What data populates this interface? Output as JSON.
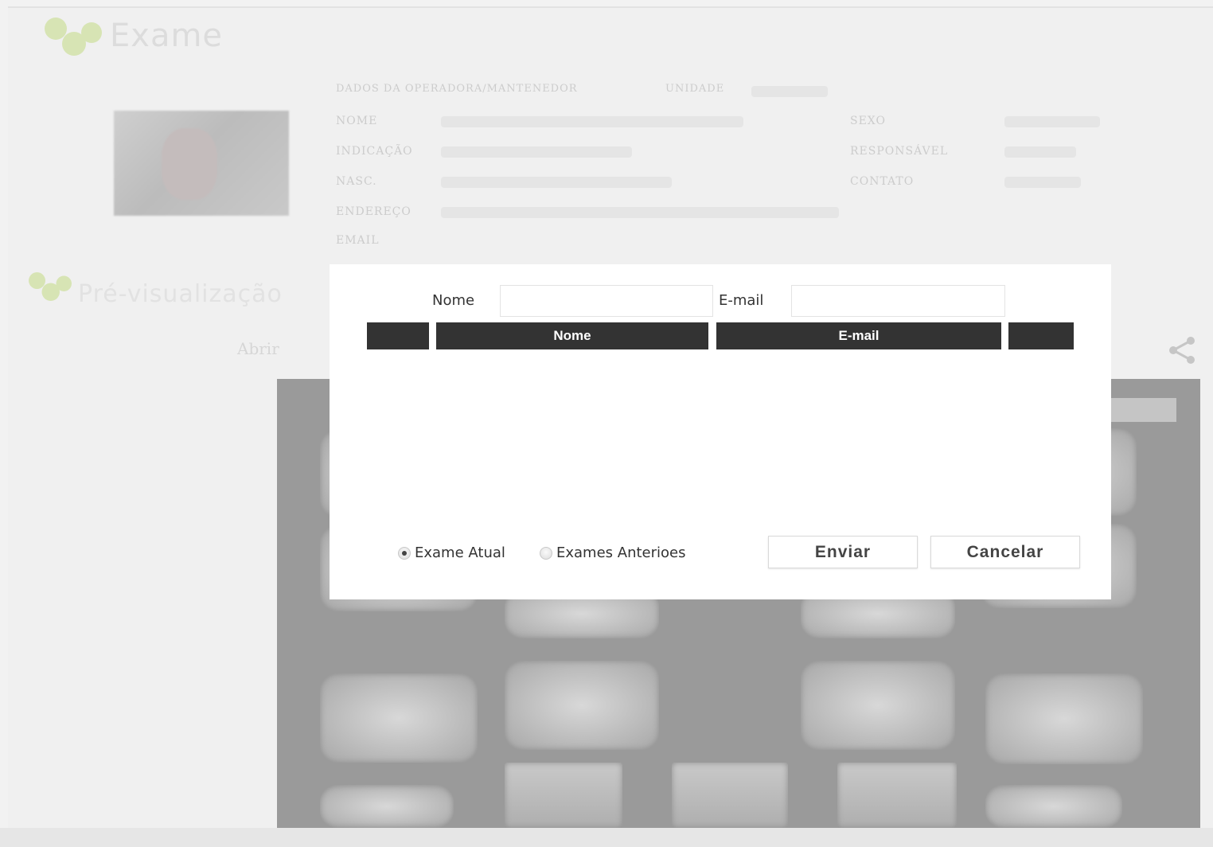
{
  "header": {
    "title": "Exame"
  },
  "patient": {
    "labels": {
      "dados": "DADOS DA OPERADORA/MANTENEDOR",
      "unidade": "UNIDADE",
      "nome": "NOME",
      "indicacao": "INDICAÇÃO",
      "nasc": "NASC.",
      "endereco": "ENDEREÇO",
      "email": "EMAIL",
      "sexo": "SEXO",
      "responsavel": "RESPONSÁVEL",
      "contato": "CONTATO"
    }
  },
  "visualizacao": {
    "title": "Pré-visualização",
    "abrir": "Abrir"
  },
  "modal": {
    "filters": {
      "nome_label": "Nome",
      "nome_value": "",
      "email_label": "E-mail",
      "email_value": ""
    },
    "table": {
      "columns": [
        "",
        "Nome",
        "E-mail",
        ""
      ],
      "rows": []
    },
    "radios": {
      "current_label": "Exame Atual",
      "previous_label": "Exames Anterioes",
      "selected": "current"
    },
    "buttons": {
      "send": "Enviar",
      "cancel": "Cancelar"
    }
  }
}
